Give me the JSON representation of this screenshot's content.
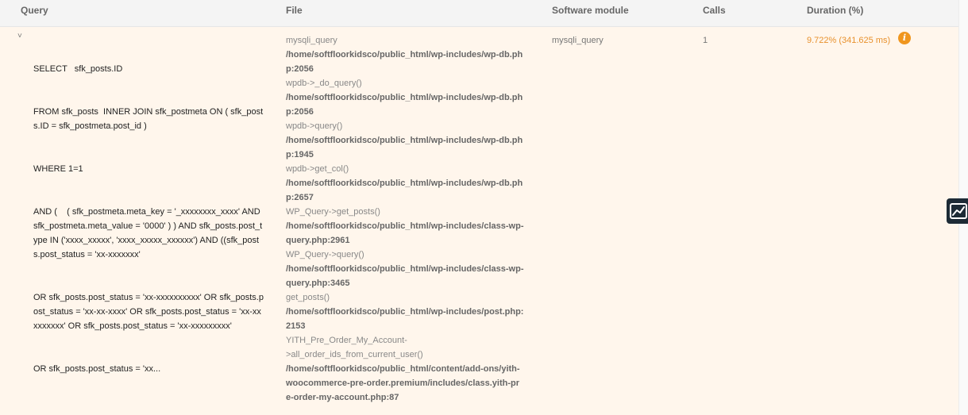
{
  "header": {
    "query": "Query",
    "file": "File",
    "module": "Software module",
    "calls": "Calls",
    "duration": "Duration (%)"
  },
  "row": {
    "toggle": "˅",
    "query_lines": [
      "SELECT   sfk_posts.ID",
      "FROM sfk_posts  INNER JOIN sfk_postmeta ON ( sfk_posts.ID = sfk_postmeta.post_id )",
      "WHERE 1=1",
      "AND (    ( sfk_postmeta.meta_key = '_xxxxxxxx_xxxx' AND sfk_postmeta.meta_value = '0000' ) ) AND sfk_posts.post_type IN ('xxxx_xxxxx', 'xxxx_xxxxx_xxxxxx') AND ((sfk_posts.post_status = 'xx-xxxxxxx'",
      "OR sfk_posts.post_status = 'xx-xxxxxxxxxx' OR sfk_posts.post_status = 'xx-xx-xxxx' OR sfk_posts.post_status = 'xx-xxxxxxxxx' OR sfk_posts.post_status = 'xx-xxxxxxxxx'",
      "OR sfk_posts.post_status = 'xx..."
    ],
    "file_entries": [
      {
        "fn": "mysqli_query",
        "path": "/home/softfloorkidsco/public_html/wp-includes/wp-db.php:2056"
      },
      {
        "fn": "wpdb->_do_query()",
        "path": "/home/softfloorkidsco/public_html/wp-includes/wp-db.php:2056"
      },
      {
        "fn": "wpdb->query()",
        "path": "/home/softfloorkidsco/public_html/wp-includes/wp-db.php:1945"
      },
      {
        "fn": "wpdb->get_col()",
        "path": "/home/softfloorkidsco/public_html/wp-includes/wp-db.php:2657"
      },
      {
        "fn": "WP_Query->get_posts()",
        "path": "/home/softfloorkidsco/public_html/wp-includes/class-wp-query.php:2961"
      },
      {
        "fn": "WP_Query->query()",
        "path": "/home/softfloorkidsco/public_html/wp-includes/class-wp-query.php:3465"
      },
      {
        "fn": "get_posts()",
        "path": "/home/softfloorkidsco/public_html/wp-includes/post.php:2153"
      },
      {
        "fn": "YITH_Pre_Order_My_Account->all_order_ids_from_current_user()",
        "path": "/home/softfloorkidsco/public_html/content/add-ons/yith-woocommerce-pre-order.premium/includes/class.yith-pre-order-my-account.php:87"
      }
    ],
    "module": "mysqli_query",
    "calls": "1",
    "duration": "9.722% (341.625 ms)",
    "info_symbol": "i"
  },
  "colors": {
    "row_bg": "#fff6ec",
    "duration": "#e8912d",
    "info_icon": "#f0961e",
    "chart_button": "#1d2b36"
  },
  "icons": {
    "info": "info-icon",
    "chart": "chart-line-icon",
    "toggle": "chevron-down-icon"
  }
}
